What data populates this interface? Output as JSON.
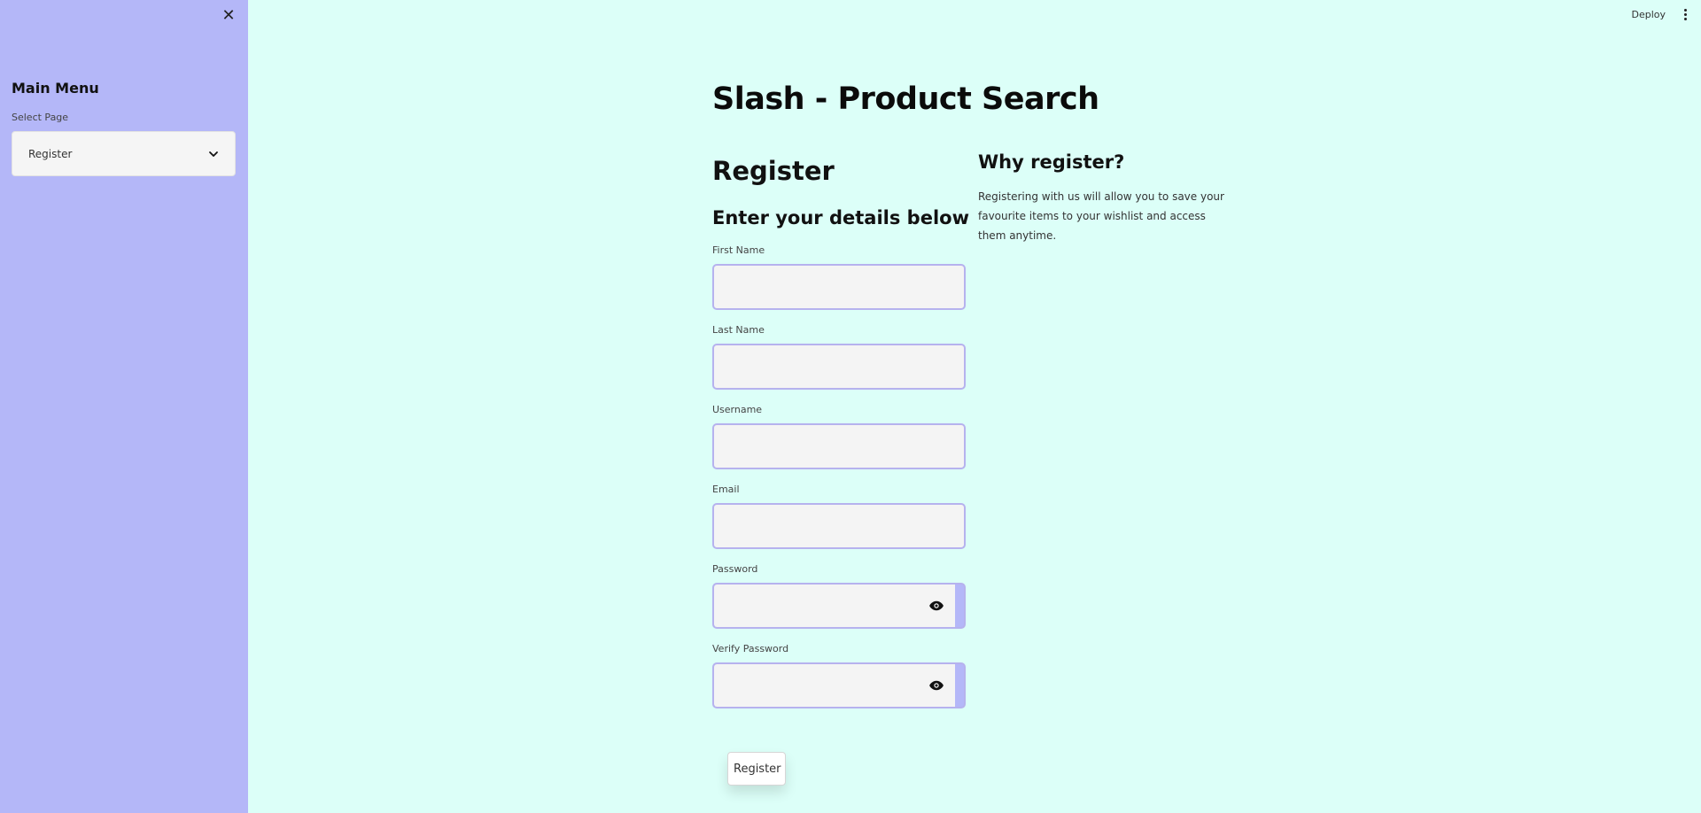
{
  "sidebar": {
    "title": "Main Menu",
    "select_label": "Select Page",
    "select_value": "Register"
  },
  "header": {
    "deploy_label": "Deploy"
  },
  "main": {
    "title": "Slash - Product Search",
    "form": {
      "heading": "Register",
      "subheading": "Enter your details below",
      "fields": [
        {
          "label": "First Name",
          "value": ""
        },
        {
          "label": "Last Name",
          "value": ""
        },
        {
          "label": "Username",
          "value": ""
        },
        {
          "label": "Email",
          "value": ""
        },
        {
          "label": "Password",
          "value": ""
        },
        {
          "label": "Verify Password",
          "value": ""
        }
      ],
      "submit_label": "Register"
    },
    "info": {
      "title": "Why register?",
      "text": "Registering with us will allow you to save your favourite items to your wishlist and access them anytime."
    }
  },
  "colors": {
    "background": "#dcfff8",
    "sidebar": "#b4b7f8",
    "field_border": "#b6b2ee",
    "field_bg": "#f4f4f4"
  },
  "icons": {
    "close": "close-icon",
    "chevron": "chevron-down-icon",
    "menu": "kebab-menu-icon",
    "eye": "eye-icon"
  }
}
